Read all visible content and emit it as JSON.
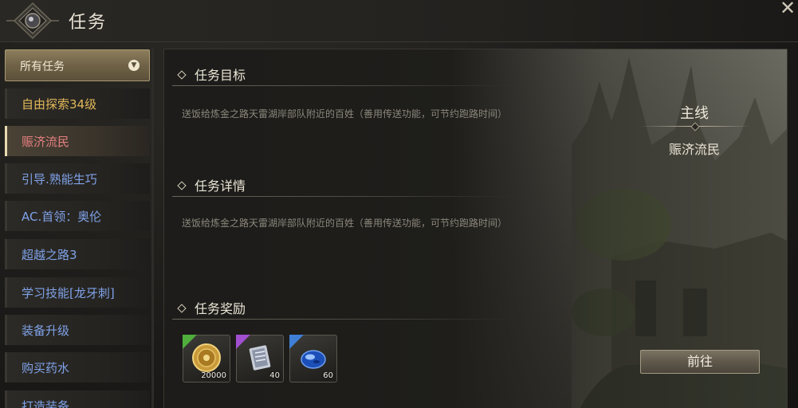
{
  "window": {
    "title": "任务",
    "close_glyph": "✕"
  },
  "sidebar": {
    "filter_label": "所有任务",
    "filter_arrow": "▼",
    "items": [
      {
        "label": "自由探索34级",
        "color": "#e2b95a"
      },
      {
        "label": "赈济流民",
        "color": "#e58080",
        "active": true
      },
      {
        "label": "引导.熟能生巧",
        "color": "#7fa2e8"
      },
      {
        "label": "AC.首领：奥伦",
        "color": "#7fa2e8"
      },
      {
        "label": "超越之路3",
        "color": "#7fa2e8"
      },
      {
        "label": "学习技能[龙牙刺]",
        "color": "#7fa2e8"
      },
      {
        "label": "装备升级",
        "color": "#7fa2e8"
      },
      {
        "label": "购买药水",
        "color": "#7fa2e8"
      },
      {
        "label": "打造装备",
        "color": "#7fa2e8"
      }
    ]
  },
  "detail": {
    "objective_title": "任务目标",
    "objective_text": "送饭给炼金之路天雷湖岸部队附近的百姓（善用传送功能，可节约跑路时间）",
    "details_title": "任务详情",
    "details_text": "送饭给炼金之路天雷湖岸部队附近的百姓（善用传送功能，可节约跑路时间）",
    "rewards_title": "任务奖励",
    "quest_type": "主线",
    "quest_name": "赈济流民",
    "go_button": "前往"
  },
  "rewards": [
    {
      "icon": "gold-coin-icon",
      "count": "20000",
      "rarity_color": "#4fae3c"
    },
    {
      "icon": "scroll-icon",
      "count": "40",
      "rarity_color": "#a14fd0"
    },
    {
      "icon": "blue-gem-icon",
      "count": "60",
      "rarity_color": "#3f7fd6"
    }
  ]
}
